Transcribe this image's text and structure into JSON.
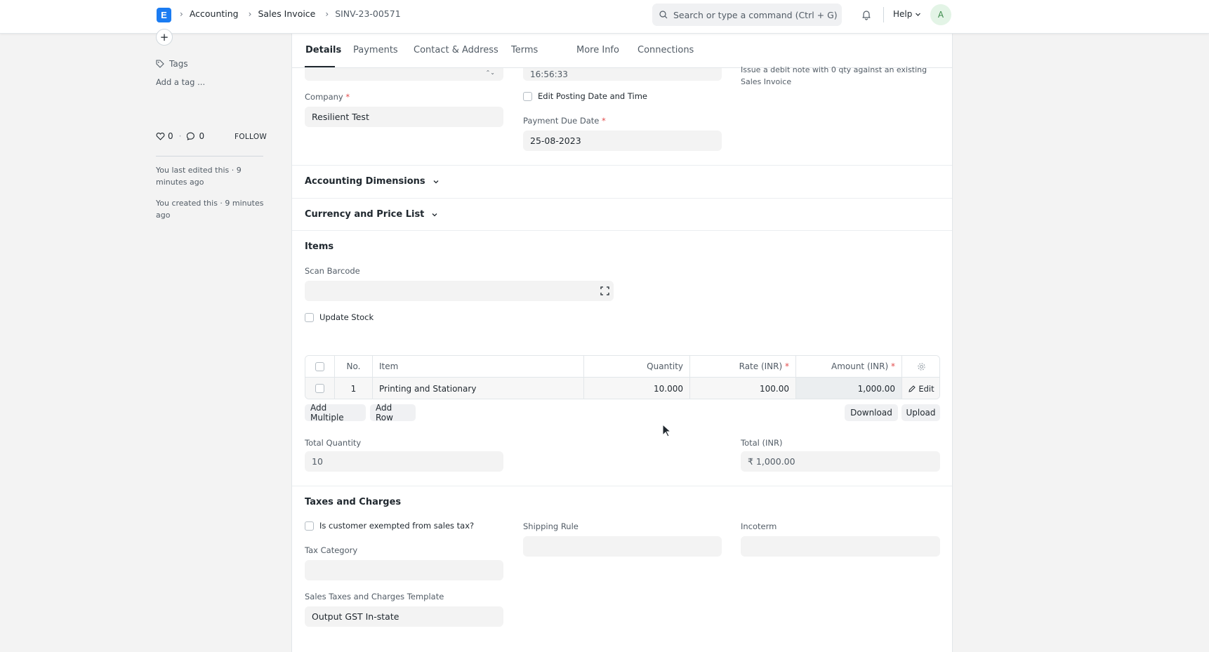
{
  "navbar": {
    "logo_letter": "E",
    "breadcrumbs": [
      "Accounting",
      "Sales Invoice",
      "SINV-23-00571"
    ],
    "search_placeholder": "Search or type a command (Ctrl + G)",
    "help_label": "Help",
    "avatar_letter": "A"
  },
  "sidebar": {
    "tags_label": "Tags",
    "add_tag": "Add a tag ...",
    "likes": "0",
    "comments": "0",
    "follow": "FOLLOW",
    "last_edited": "You last edited this · 9 minutes ago",
    "created": "You created this · 9 minutes ago"
  },
  "tabs": [
    "Details",
    "Payments",
    "Contact & Address",
    "Terms",
    "More Info",
    "Connections"
  ],
  "details": {
    "posting_time": "16:56:33",
    "debit_note_hint": "Issue a debit note with 0 qty against an existing Sales Invoice",
    "company_label": "Company",
    "company_value": "Resilient Test",
    "edit_posting_label": "Edit Posting Date and Time",
    "due_date_label": "Payment Due Date",
    "due_date_value": "25-08-2023"
  },
  "sections": {
    "accounting_dimensions": "Accounting Dimensions",
    "currency_price_list": "Currency and Price List",
    "items": "Items",
    "taxes": "Taxes and Charges"
  },
  "items": {
    "scan_barcode_label": "Scan Barcode",
    "update_stock_label": "Update Stock",
    "columns": {
      "no": "No.",
      "item": "Item",
      "quantity": "Quantity",
      "rate": "Rate (INR)",
      "amount": "Amount (INR)"
    },
    "rows": [
      {
        "no": "1",
        "item": "Printing and Stationary",
        "quantity": "10.000",
        "rate": "100.00",
        "amount": "1,000.00",
        "edit": "Edit"
      }
    ],
    "add_multiple": "Add Multiple",
    "add_row": "Add Row",
    "download": "Download",
    "upload": "Upload",
    "total_quantity_label": "Total Quantity",
    "total_quantity_value": "10",
    "total_label": "Total (INR)",
    "total_value": "₹ 1,000.00"
  },
  "taxes": {
    "exempt_label": "Is customer exempted from sales tax?",
    "shipping_rule_label": "Shipping Rule",
    "incoterm_label": "Incoterm",
    "tax_category_label": "Tax Category",
    "template_label": "Sales Taxes and Charges Template",
    "template_value": "Output GST In-state"
  }
}
